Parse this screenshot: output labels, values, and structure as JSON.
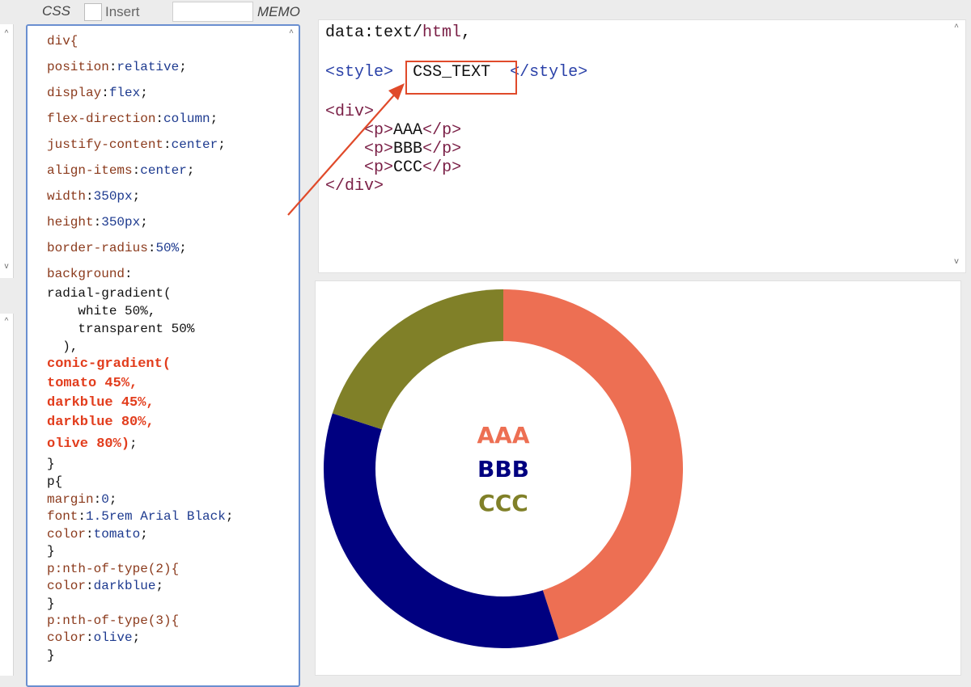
{
  "toolbar": {
    "css_label": "CSS",
    "insert_label": "Insert",
    "memo_label": "MEMO",
    "memo_value": ""
  },
  "css_editor": {
    "lines": [
      {
        "prop": "div{"
      },
      {
        "prop": "position",
        "val": "relative"
      },
      {
        "prop": "display",
        "val": "flex"
      },
      {
        "prop": "flex-direction",
        "val": "column"
      },
      {
        "prop": "justify-content",
        "val": "center"
      },
      {
        "prop": "align-items",
        "val": "center"
      },
      {
        "prop": "width",
        "val": "350px"
      },
      {
        "prop": "height",
        "val": "350px"
      },
      {
        "prop": "border-radius",
        "val": "50%"
      },
      {
        "prop": "background",
        "val": ""
      },
      {
        "plain": "radial-gradient("
      },
      {
        "plain": "    white 50%,"
      },
      {
        "plain": "    transparent 50%"
      },
      {
        "plain": "  ),"
      },
      {
        "hl": "conic-gradient("
      },
      {
        "hl": "tomato 45%,"
      },
      {
        "hl": "darkblue 45%,"
      },
      {
        "hl": "darkblue 80%,"
      },
      {
        "hl": "olive 80%)",
        "tail": ";"
      },
      {
        "plain": "}"
      },
      {
        "plain": "p{"
      },
      {
        "prop": "margin",
        "val": "0"
      },
      {
        "prop": "font",
        "val": "1.5rem Arial Black"
      },
      {
        "prop": "color",
        "val": "tomato"
      },
      {
        "plain": "}"
      },
      {
        "prop": "p:nth-of-type(2){"
      },
      {
        "prop": "color",
        "val": "darkblue"
      },
      {
        "plain": "}"
      },
      {
        "prop": "p:nth-of-type(3){"
      },
      {
        "prop": "color",
        "val": "olive"
      },
      {
        "plain": "}"
      }
    ]
  },
  "html_source": {
    "line1_prefix": "data:text/",
    "line1_html": "html",
    "line1_suffix": ",",
    "style_open": "style",
    "css_text": "CSS_TEXT",
    "style_close": "style",
    "div_open": "div",
    "p1": "AAA",
    "p2": "BBB",
    "p3": "CCC",
    "p_tag": "p",
    "div_close": "div"
  },
  "preview": {
    "chart_data": {
      "type": "pie",
      "variant": "donut",
      "slices": [
        {
          "label": "tomato",
          "value": 45,
          "color": "#ed6f53"
        },
        {
          "label": "darkblue",
          "value": 35,
          "color": "#000080"
        },
        {
          "label": "olive",
          "value": 20,
          "color": "#808028"
        }
      ],
      "inner_radius_ratio": 0.5
    },
    "labels": [
      {
        "text": "AAA",
        "color": "#ed6f53"
      },
      {
        "text": "BBB",
        "color": "#000080"
      },
      {
        "text": "CCC",
        "color": "#808028"
      }
    ]
  },
  "colors": {
    "accent": "#e04a2a",
    "editor_border": "#6a8fd0"
  },
  "icons": {
    "scroll_up": "chevron-up-icon",
    "scroll_down": "chevron-down-icon"
  }
}
